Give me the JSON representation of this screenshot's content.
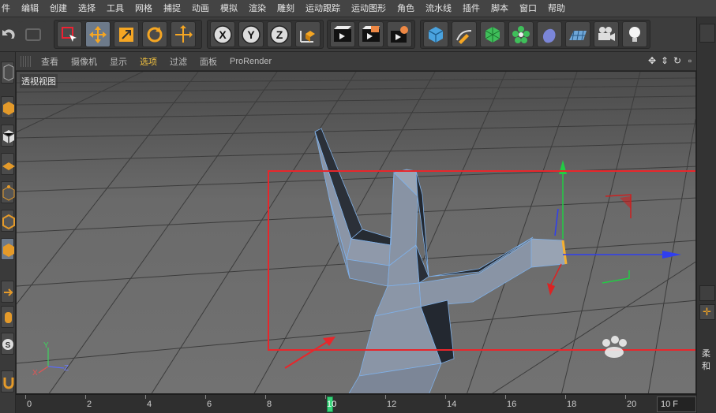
{
  "menu": [
    "件",
    "编辑",
    "创建",
    "选择",
    "工具",
    "网格",
    "捕捉",
    "动画",
    "模拟",
    "渲染",
    "雕刻",
    "运动跟踪",
    "运动图形",
    "角色",
    "流水线",
    "插件",
    "脚本",
    "窗口",
    "帮助"
  ],
  "viewport_menu": [
    "查看",
    "摄像机",
    "显示",
    "选项",
    "过滤",
    "面板",
    "ProRender"
  ],
  "viewport_active_menu": "选项",
  "viewport_label": "透视视图",
  "toolbar_icons": [
    "undo-icon",
    "redo-icon",
    "live-select-icon",
    "move-icon",
    "scale-icon",
    "rotate-icon",
    "transform-icon",
    "x-axis-icon",
    "y-axis-icon",
    "z-axis-icon",
    "world-coordinates-icon",
    "render-view-icon",
    "render-picture-viewer-icon",
    "render-settings-icon",
    "cube-icon",
    "pen-icon",
    "subdivision-icon",
    "cloner-icon",
    "deformer-icon",
    "floor-icon",
    "camera-icon",
    "light-icon"
  ],
  "axis_labels": {
    "x": "X",
    "y": "Y",
    "z": "Z"
  },
  "timeline": {
    "ticks": [
      "0",
      "2",
      "4",
      "6",
      "8",
      "10",
      "12",
      "14",
      "16",
      "18",
      "20"
    ],
    "current_frame": "10",
    "frame_field": "10 F"
  },
  "right_panel_text": "柔和",
  "colors": {
    "accent": "#f0c040",
    "highlight_box": "#e8262b",
    "x_axis": "#2f3ef0",
    "y_axis": "#22cc44",
    "z_axis": "#dd2222",
    "playhead": "#37d37a"
  }
}
